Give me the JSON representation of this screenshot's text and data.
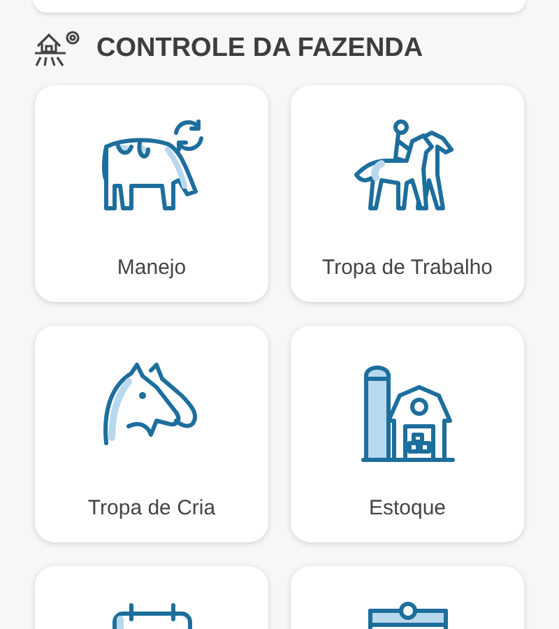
{
  "section": {
    "title": "CONTROLE DA FAZENDA"
  },
  "cards": [
    {
      "kind": "cow",
      "label": "Manejo"
    },
    {
      "kind": "riders",
      "label": "Tropa de Trabalho"
    },
    {
      "kind": "horses",
      "label": "Tropa de Cria"
    },
    {
      "kind": "barn",
      "label": "Estoque"
    },
    {
      "kind": "calendar"
    },
    {
      "kind": "clipboard"
    }
  ]
}
